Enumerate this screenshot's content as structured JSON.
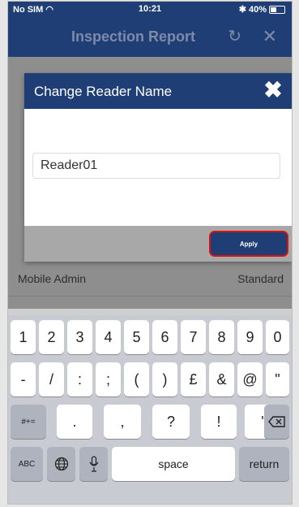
{
  "status_bar": {
    "carrier": "No SIM",
    "wifi_icon": "wifi-icon",
    "time": "10:21",
    "bluetooth": "✱",
    "battery_percent": "40%",
    "battery_level": 0.4
  },
  "navbar": {
    "title": "Inspection Report",
    "refresh_icon": "refresh-icon",
    "close_icon": "close-icon"
  },
  "background_row": {
    "label": "Mobile Admin",
    "value": "Standard"
  },
  "dialog": {
    "title": "Change Reader Name",
    "close_icon": "close-icon",
    "input_value": "Reader01",
    "apply_label": "Apply"
  },
  "keyboard": {
    "row1": [
      "1",
      "2",
      "3",
      "4",
      "5",
      "6",
      "7",
      "8",
      "9",
      "0"
    ],
    "row2": [
      "-",
      "/",
      ":",
      ";",
      "(",
      ")",
      "£",
      "&",
      "@",
      "\""
    ],
    "row3_left": "#+=",
    "row3": [
      ".",
      ",",
      "?",
      "!",
      "'"
    ],
    "row3_right": "delete-icon",
    "abc": "ABC",
    "globe": "globe-icon",
    "mic": "mic-icon",
    "space": "space",
    "return": "return"
  }
}
